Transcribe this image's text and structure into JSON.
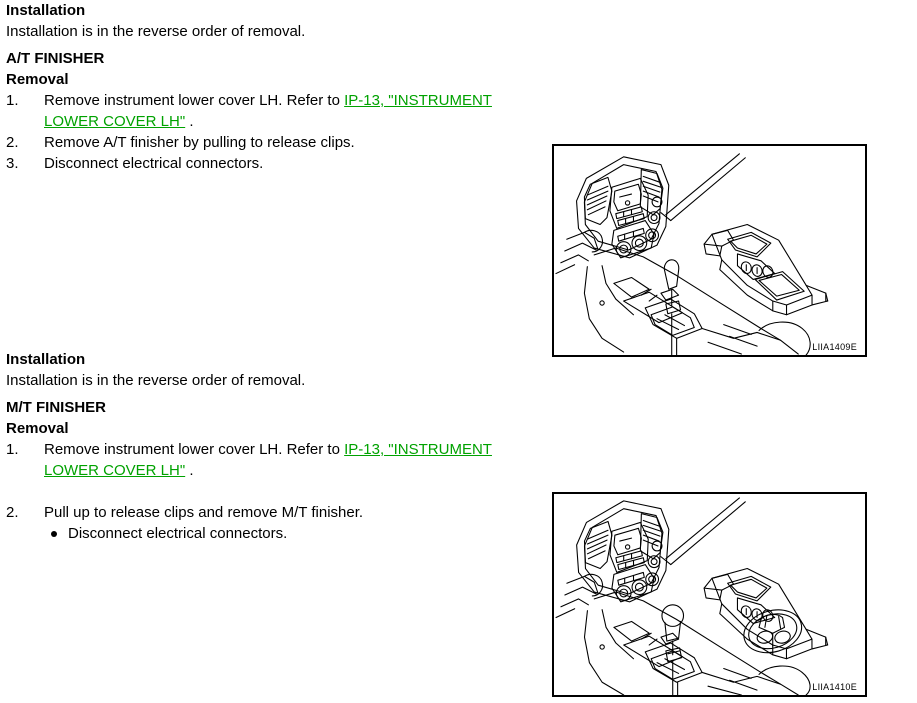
{
  "document": {
    "type": "service-manual-page",
    "link_color": "#00a200",
    "text_color": "#000000",
    "background": "#ffffff"
  },
  "sections": [
    {
      "id": "at-installation",
      "heading": "Installation",
      "paragraph": "Installation is in the reverse order of removal."
    },
    {
      "id": "at-finisher",
      "heading": "A/T FINISHER",
      "subheading": "Removal",
      "steps": [
        {
          "number": "1.",
          "text_before": "Remove instrument lower cover LH. Refer to ",
          "link": "IP-13, \"INSTRUMENT LOWER COVER LH\"",
          "text_after": " ."
        },
        {
          "number": "2.",
          "text_before": "Remove A/T finisher by pulling to release clips.",
          "link": "",
          "text_after": ""
        },
        {
          "number": "3.",
          "text_before": "Disconnect electrical connectors.",
          "link": "",
          "text_after": ""
        }
      ]
    },
    {
      "id": "mt-installation",
      "heading": "Installation",
      "paragraph": "Installation is in the reverse order of removal."
    },
    {
      "id": "mt-finisher",
      "heading": "M/T FINISHER",
      "subheading": "Removal",
      "steps": [
        {
          "number": "1.",
          "text_before": "Remove instrument lower cover LH. Refer to ",
          "link": "IP-13, \"INSTRUMENT LOWER COVER LH\"",
          "text_after": " ."
        },
        {
          "number": "2.",
          "text_before": "Pull up to release clips and remove M/T finisher.",
          "link": "",
          "text_after": ""
        }
      ],
      "bullets": [
        "Disconnect electrical connectors."
      ]
    }
  ],
  "figures": [
    {
      "id": "figure-at",
      "caption": "LIIA1409E",
      "description": "Center console with A/T finisher removed"
    },
    {
      "id": "figure-mt",
      "caption": "LIIA1410E",
      "description": "Center console with M/T finisher removed"
    }
  ]
}
